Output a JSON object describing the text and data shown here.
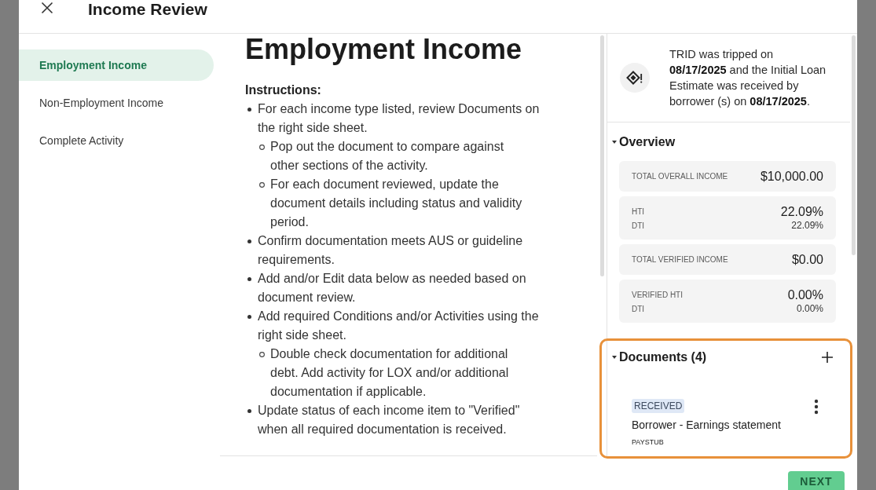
{
  "dialog": {
    "title": "Income Review"
  },
  "nav": {
    "items": [
      {
        "label": "Employment Income",
        "selected": true
      },
      {
        "label": "Non-Employment Income",
        "selected": false
      },
      {
        "label": "Complete Activity",
        "selected": false
      }
    ]
  },
  "content": {
    "heading": "Employment Income",
    "instructions_title": "Instructions:",
    "instructions": [
      {
        "text": "For each income type listed, review Documents on the right side sheet.",
        "children": [
          {
            "text": "Pop out the document to compare against other sections of the activity."
          },
          {
            "text": "For each document reviewed, update the document details including status and validity period."
          }
        ]
      },
      {
        "text": "Confirm documentation meets AUS or guideline requirements."
      },
      {
        "text": "Add and/or Edit data below as needed based on document review."
      },
      {
        "text": "Add required Conditions and/or Activities using the right side sheet.",
        "children": [
          {
            "text": "Double check documentation for additional debt. Add activity for LOX and/or additional documentation if applicable."
          }
        ]
      },
      {
        "text": "Update status of each income item to \"Verified\" when all required documentation is received."
      }
    ]
  },
  "notice": {
    "text": "TRID was tripped on **08/17/2025** and the Initial Loan Estimate was received by borrower (s) on **08/17/2025**."
  },
  "overview": {
    "title": "Overview",
    "expanded": true,
    "cards": [
      {
        "rows": [
          {
            "kind": "main",
            "label": "TOTAL OVERALL INCOME",
            "value": "$10,000.00"
          }
        ]
      },
      {
        "rows": [
          {
            "kind": "main",
            "label": "HTI",
            "value": "22.09%"
          },
          {
            "kind": "sub",
            "label": "DTI",
            "value": "22.09%"
          }
        ]
      },
      {
        "rows": [
          {
            "kind": "main",
            "label": "TOTAL VERIFIED INCOME",
            "value": "$0.00"
          }
        ]
      },
      {
        "rows": [
          {
            "kind": "main",
            "label": "VERIFIED HTI",
            "value": "0.00%"
          },
          {
            "kind": "sub",
            "label": "DTI",
            "value": "0.00%"
          }
        ]
      }
    ]
  },
  "documents": {
    "title": "Documents (4)",
    "expanded": true,
    "highlighted": true,
    "items": [
      {
        "status": "RECEIVED",
        "name": "Borrower - Earnings statement",
        "type": "PAYSTUB"
      }
    ]
  },
  "footer": {
    "buttons": [
      "NEXT"
    ]
  }
}
